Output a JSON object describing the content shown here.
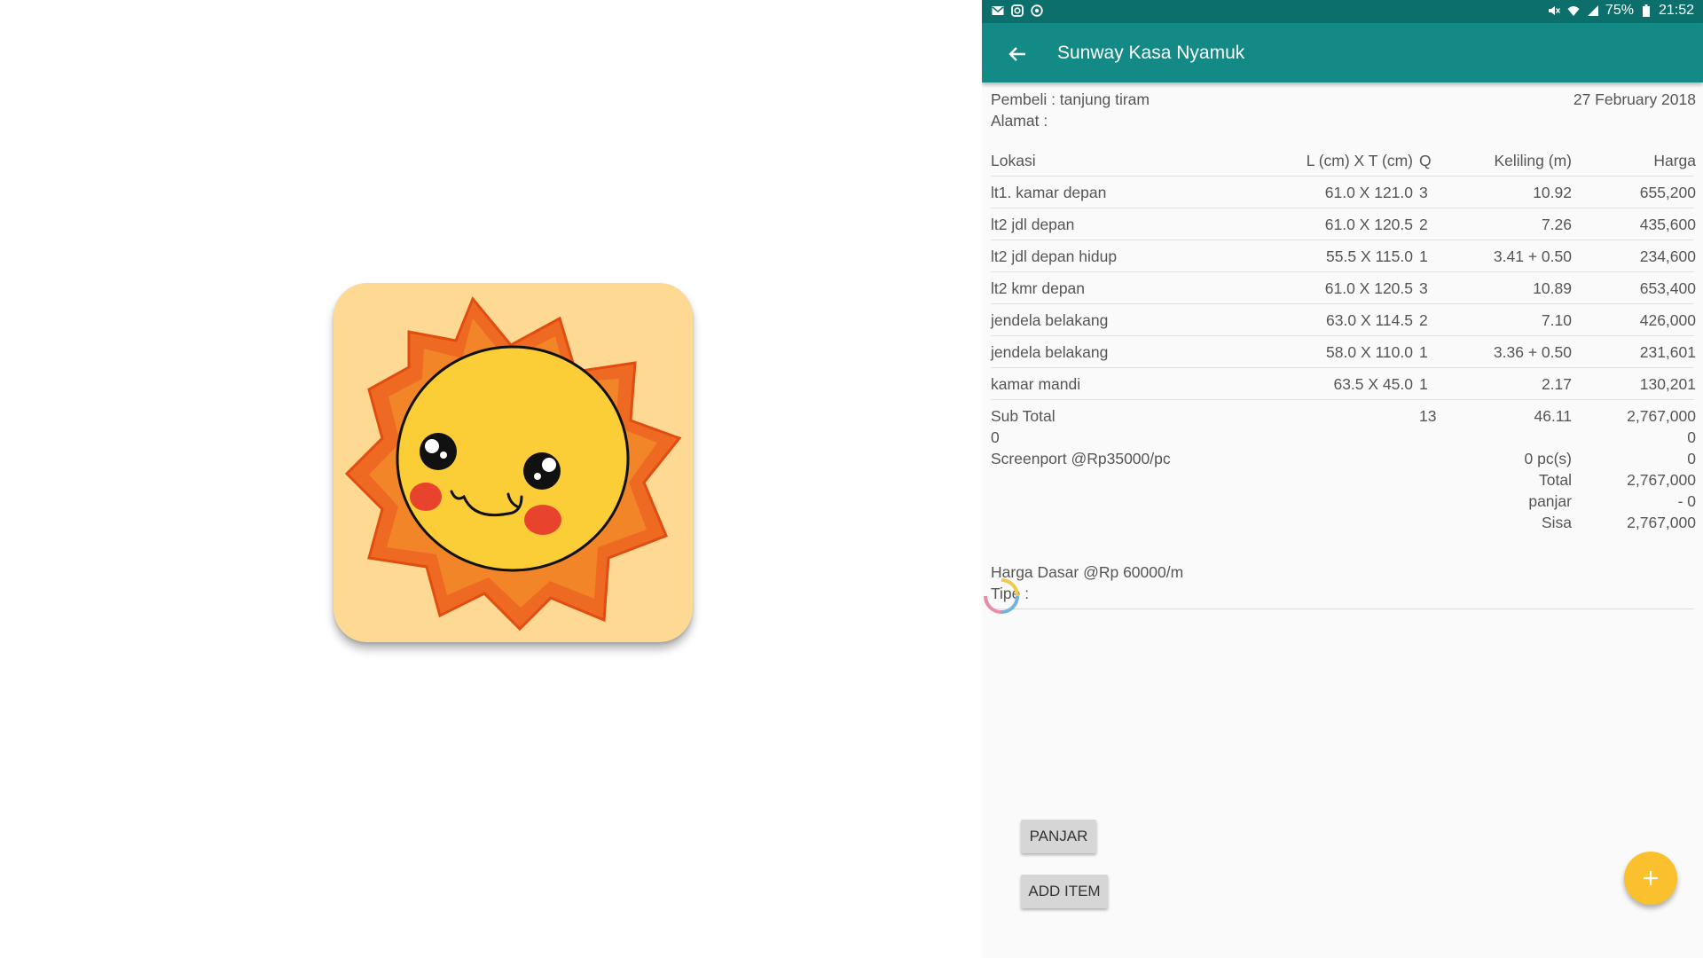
{
  "status_bar": {
    "left_icons": [
      "mail-icon",
      "instagram-icon",
      "app-notification-icon"
    ],
    "right_text": "75%",
    "time": "21:52",
    "right_icons": [
      "mute-icon",
      "wifi-icon",
      "signal-icon",
      "battery-icon"
    ]
  },
  "appbar": {
    "title": "Sunway Kasa Nyamuk",
    "back_icon": "arrow-back-icon"
  },
  "header": {
    "pembeli": "Pembeli : tanjung tiram",
    "alamat": "Alamat :",
    "date": "27 February 2018"
  },
  "table": {
    "columns": {
      "lokasi": "Lokasi",
      "dim": "L (cm) X T (cm)",
      "q": "Q",
      "keliling": "Keliling (m)",
      "harga": "Harga"
    },
    "rows": [
      {
        "lokasi": "lt1. kamar depan",
        "dim": "61.0 X 121.0",
        "q": "3",
        "keliling": "10.92",
        "harga": "655,200"
      },
      {
        "lokasi": "lt2 jdl depan",
        "dim": "61.0 X 120.5",
        "q": "2",
        "keliling": "7.26",
        "harga": "435,600"
      },
      {
        "lokasi": "lt2 jdl depan hidup",
        "dim": "55.5 X 115.0",
        "q": "1",
        "keliling": "3.41 + 0.50",
        "harga": "234,600"
      },
      {
        "lokasi": "lt2 kmr depan",
        "dim": "61.0 X 120.5",
        "q": "3",
        "keliling": "10.89",
        "harga": "653,400"
      },
      {
        "lokasi": "jendela belakang",
        "dim": "63.0 X 114.5",
        "q": "2",
        "keliling": "7.10",
        "harga": "426,000"
      },
      {
        "lokasi": "jendela belakang",
        "dim": "58.0 X 110.0",
        "q": "1",
        "keliling": "3.36 + 0.50",
        "harga": "231,601"
      },
      {
        "lokasi": "kamar mandi",
        "dim": "63.5 X 45.0",
        "q": "1",
        "keliling": "2.17",
        "harga": "130,201"
      }
    ]
  },
  "summary": {
    "subtotal_label": "Sub Total",
    "subtotal_q": "13",
    "subtotal_keliling": "46.11",
    "subtotal_harga": "2,767,000",
    "zero_left": "0",
    "zero_right": "0",
    "screenport_label": "Screenport @Rp35000/pc",
    "screenport_count": "0 pc(s)",
    "screenport_value": "0",
    "total_label": "Total",
    "total_value": "2,767,000",
    "panjar_label": "panjar",
    "panjar_value": "- 0",
    "sisa_label": "Sisa",
    "sisa_value": "2,767,000"
  },
  "footer_info": {
    "harga_dasar": "Harga Dasar @Rp 60000/m",
    "tipe": "Tipe :"
  },
  "buttons": {
    "panjar": "PANJAR",
    "add_item": "ADD ITEM",
    "fab_icon": "plus-icon"
  },
  "colors": {
    "status_bar": "#0d6f6b",
    "app_bar": "#148a86",
    "fab": "#fbc02d",
    "icon_bg": "#fdd993"
  }
}
